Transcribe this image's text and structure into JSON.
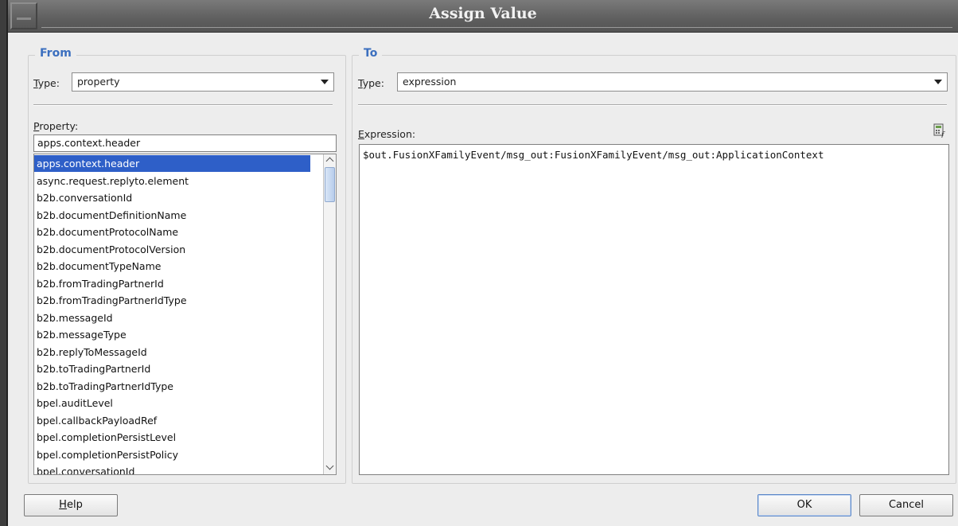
{
  "dialog": {
    "title": "Assign Value"
  },
  "from": {
    "legend": "From",
    "type_label": "Type:",
    "type_value": "property",
    "property_label": "Property:",
    "property_input_value": "apps.context.header",
    "selected_index": 0,
    "property_items": [
      "apps.context.header",
      "async.request.replyto.element",
      "b2b.conversationId",
      "b2b.documentDefinitionName",
      "b2b.documentProtocolName",
      "b2b.documentProtocolVersion",
      "b2b.documentTypeName",
      "b2b.fromTradingPartnerId",
      "b2b.fromTradingPartnerIdType",
      "b2b.messageId",
      "b2b.messageType",
      "b2b.replyToMessageId",
      "b2b.toTradingPartnerId",
      "b2b.toTradingPartnerIdType",
      "bpel.auditLevel",
      "bpel.callbackPayloadRef",
      "bpel.completionPersistLevel",
      "bpel.completionPersistPolicy",
      "bpel.conversationId"
    ]
  },
  "to": {
    "legend": "To",
    "type_label": "Type:",
    "type_value": "expression",
    "expression_label": "Expression:",
    "expression_value": "$out.FusionXFamilyEvent/msg_out:FusionXFamilyEvent/msg_out:ApplicationContext",
    "expression_builder_icon": "expression-builder-icon"
  },
  "buttons": {
    "help": "Help",
    "ok": "OK",
    "cancel": "Cancel"
  },
  "colors": {
    "legend": "#3b6fbf",
    "selection": "#2e5fc8",
    "titlebar": "#5e5e5e"
  }
}
